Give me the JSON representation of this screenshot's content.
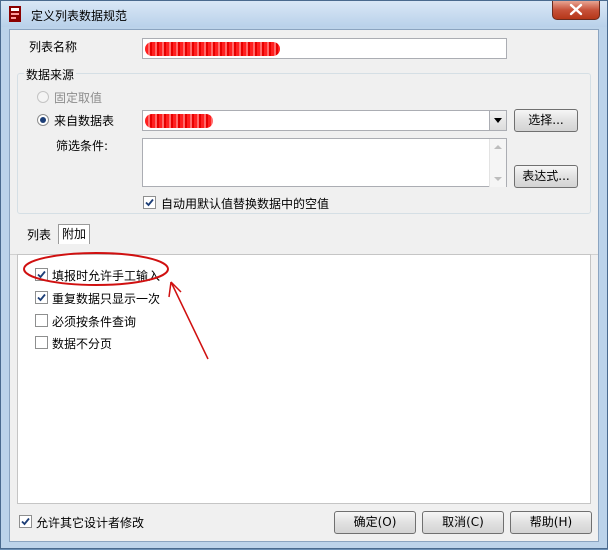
{
  "window": {
    "title": "定义列表数据规范"
  },
  "list_name": {
    "label": "列表名称",
    "value_redacted": true
  },
  "data_source": {
    "group_title": "数据来源",
    "fixed_value_label": "固定取值",
    "from_table_label": "来自数据表",
    "select_button": "选择...",
    "filter_label": "筛选条件:",
    "filter_value": "",
    "expression_button": "表达式...",
    "auto_default_label": "自动用默认值替换数据中的空值",
    "auto_default_checked": true
  },
  "tabs": [
    {
      "label": "列表",
      "active": false
    },
    {
      "label": "附加",
      "active": true
    }
  ],
  "options": [
    {
      "label": "填报时允许手工输入",
      "checked": true
    },
    {
      "label": "重复数据只显示一次",
      "checked": true
    },
    {
      "label": "必须按条件查询",
      "checked": false
    },
    {
      "label": "数据不分页",
      "checked": false
    }
  ],
  "footer": {
    "allow_modify_label": "允许其它设计者修改",
    "allow_modify_checked": true,
    "ok_button": "确定(O)",
    "cancel_button": "取消(C)",
    "help_button": "帮助(H)"
  },
  "colors": {
    "annotation": "#d01010",
    "window_frame": "#bcd3ea",
    "close_button": "#c7523a"
  }
}
